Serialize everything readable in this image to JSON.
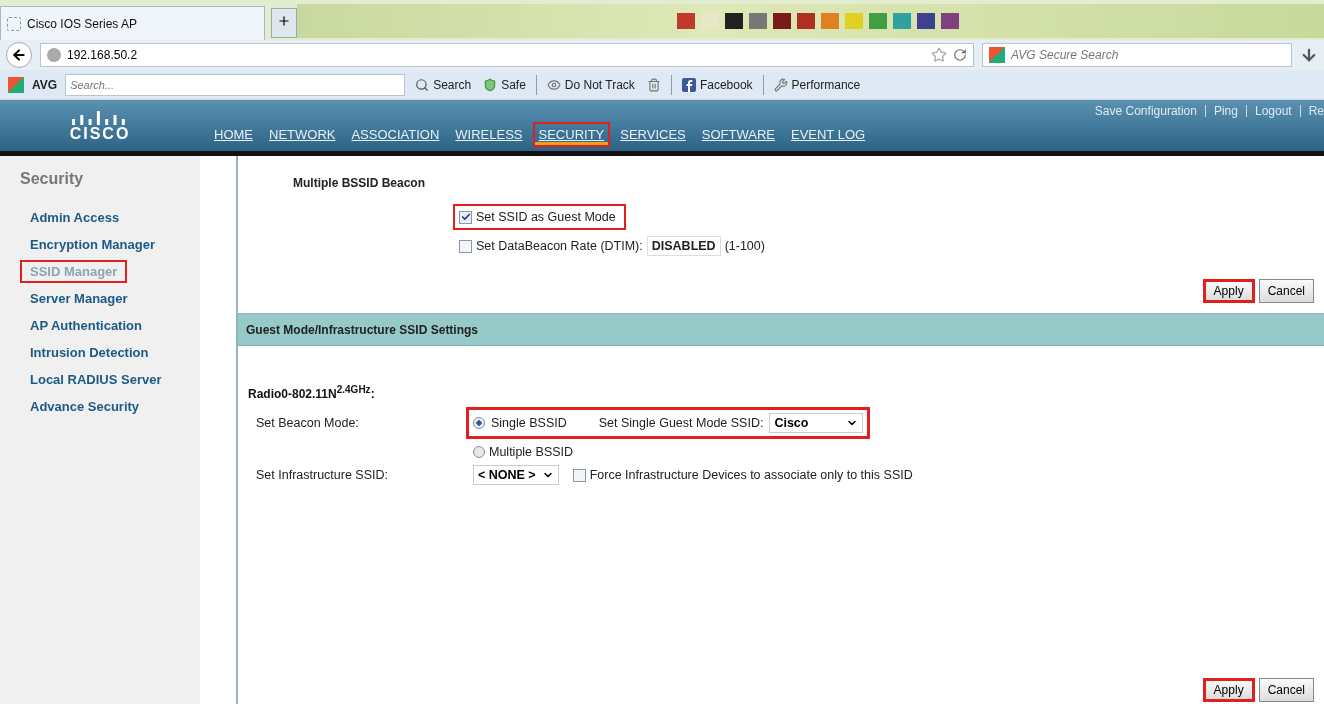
{
  "browser": {
    "tab": {
      "title": "Cisco IOS Series AP"
    },
    "address": "192.168.50.2",
    "search_placeholder": "AVG Secure Search",
    "toolbar": {
      "brand": "AVG",
      "search_placeholder": "Search...",
      "items": [
        {
          "kind": "search",
          "label": "Search"
        },
        {
          "kind": "shield",
          "label": "Safe"
        },
        {
          "kind": "eye",
          "label": "Do Not Track"
        },
        {
          "kind": "trash"
        },
        {
          "kind": "facebook",
          "label": "Facebook"
        },
        {
          "kind": "wrench",
          "label": "Performance"
        }
      ]
    }
  },
  "header": {
    "logo": "CISCO",
    "utility_links": [
      "Save Configuration",
      "Ping",
      "Logout",
      "Re"
    ],
    "nav": [
      {
        "label": "HOME",
        "selected": false,
        "highlighted": false
      },
      {
        "label": "NETWORK",
        "selected": false,
        "highlighted": false
      },
      {
        "label": "ASSOCIATION",
        "selected": false,
        "highlighted": false
      },
      {
        "label": "WIRELESS",
        "selected": false,
        "highlighted": false
      },
      {
        "label": "SECURITY",
        "selected": true,
        "highlighted": true
      },
      {
        "label": "SERVICES",
        "selected": false,
        "highlighted": false
      },
      {
        "label": "SOFTWARE",
        "selected": false,
        "highlighted": false
      },
      {
        "label": "EVENT LOG",
        "selected": false,
        "highlighted": false
      }
    ]
  },
  "sidebar": {
    "title": "Security",
    "items": [
      {
        "label": "Admin Access",
        "selected": false,
        "highlighted": false
      },
      {
        "label": "Encryption Manager",
        "selected": false,
        "highlighted": false
      },
      {
        "label": "SSID Manager",
        "selected": true,
        "highlighted": true
      },
      {
        "label": "Server Manager",
        "selected": false,
        "highlighted": false
      },
      {
        "label": "AP Authentication",
        "selected": false,
        "highlighted": false
      },
      {
        "label": "Intrusion Detection",
        "selected": false,
        "highlighted": false
      },
      {
        "label": "Local RADIUS Server",
        "selected": false,
        "highlighted": false
      },
      {
        "label": "Advance Security",
        "selected": false,
        "highlighted": false
      }
    ]
  },
  "beacon": {
    "title": "Multiple BSSID Beacon",
    "guest_mode": {
      "label": "Set SSID as Guest Mode",
      "checked": true,
      "highlighted": true
    },
    "dtim": {
      "label": "Set DataBeacon Rate (DTIM):",
      "checked": false,
      "value": "DISABLED",
      "range": "(1-100)"
    },
    "buttons": [
      {
        "label": "Apply",
        "highlighted": true
      },
      {
        "label": "Cancel",
        "highlighted": false
      }
    ]
  },
  "guest": {
    "header": "Guest Mode/Infrastructure SSID Settings",
    "radio": "Radio0-802.11N$^{2.4GHz}$:",
    "beacon_mode_label": "Set Beacon Mode:",
    "modes": [
      {
        "label": "Single BSSID",
        "selected": true
      },
      {
        "label": "Multiple BSSID",
        "selected": false
      }
    ],
    "single_ssid_label": "Set Single Guest Mode SSID:",
    "single_ssid_value": "Cisco",
    "mode_highlighted": true,
    "infra_label": "Set Infrastructure SSID:",
    "infra_value": "< NONE >",
    "force": {
      "label": "Force Infrastructure Devices to associate only to this SSID",
      "checked": false
    },
    "buttons": [
      {
        "label": "Apply",
        "highlighted": true
      },
      {
        "label": "Cancel",
        "highlighted": false
      }
    ]
  }
}
